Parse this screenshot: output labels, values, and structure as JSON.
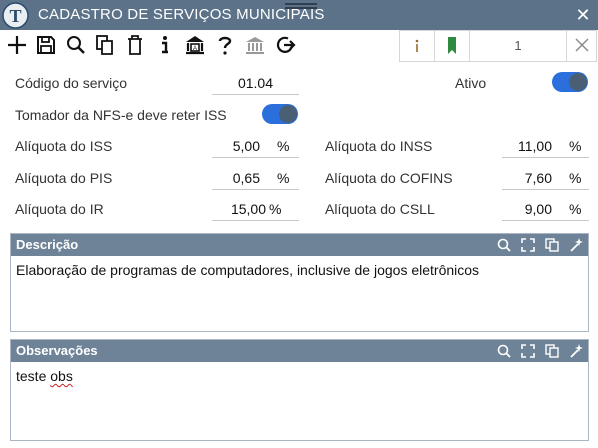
{
  "window": {
    "title": "CADASTRO DE SERVIÇOS MUNICIPAIS",
    "logo_letter": "T",
    "close_glyph": "✕"
  },
  "toolbar": {
    "icons": [
      "add-icon",
      "save-icon",
      "search-icon",
      "copy-icon",
      "delete-icon",
      "info-icon",
      "institution-icon",
      "help-icon",
      "bank-icon",
      "refresh-icon"
    ]
  },
  "navigator": {
    "info_icon": "info-icon",
    "bookmark_icon": "bookmark-icon",
    "record_number": "1",
    "close_icon": "close-icon",
    "bookmark_color": "#2e8b3d"
  },
  "form": {
    "codigo_label": "Código do serviço",
    "codigo_value": "01.04",
    "ativo_label": "Ativo",
    "ativo_on": true,
    "tomador_label": "Tomador da NFS-e deve reter ISS",
    "tomador_on": true,
    "iss_label": "Alíquota do ISS",
    "iss_value": "5,00",
    "inss_label": "Alíquota do INSS",
    "inss_value": "11,00",
    "pis_label": "Alíquota do PIS",
    "pis_value": "0,65",
    "cofins_label": "Alíquota do COFINS",
    "cofins_value": "7,60",
    "ir_label": "Alíquota do IR",
    "ir_value": "15,00",
    "csll_label": "Alíquota do CSLL",
    "csll_value": "9,00",
    "percent": "%"
  },
  "descricao": {
    "title": "Descrição",
    "text": "Elaboração de programas de computadores, inclusive de jogos eletrônicos",
    "icons": [
      "search-icon",
      "expand-icon",
      "copy-icon",
      "magic-wand-icon"
    ]
  },
  "observacoes": {
    "title": "Observações",
    "text_plain": "teste ",
    "text_flagged": "obs",
    "icons": [
      "search-icon",
      "expand-icon",
      "copy-icon",
      "magic-wand-icon"
    ]
  },
  "colors": {
    "titlebar": "#5b7289",
    "section_header": "#6f8398",
    "toggle_on": "#2a6fdb"
  }
}
